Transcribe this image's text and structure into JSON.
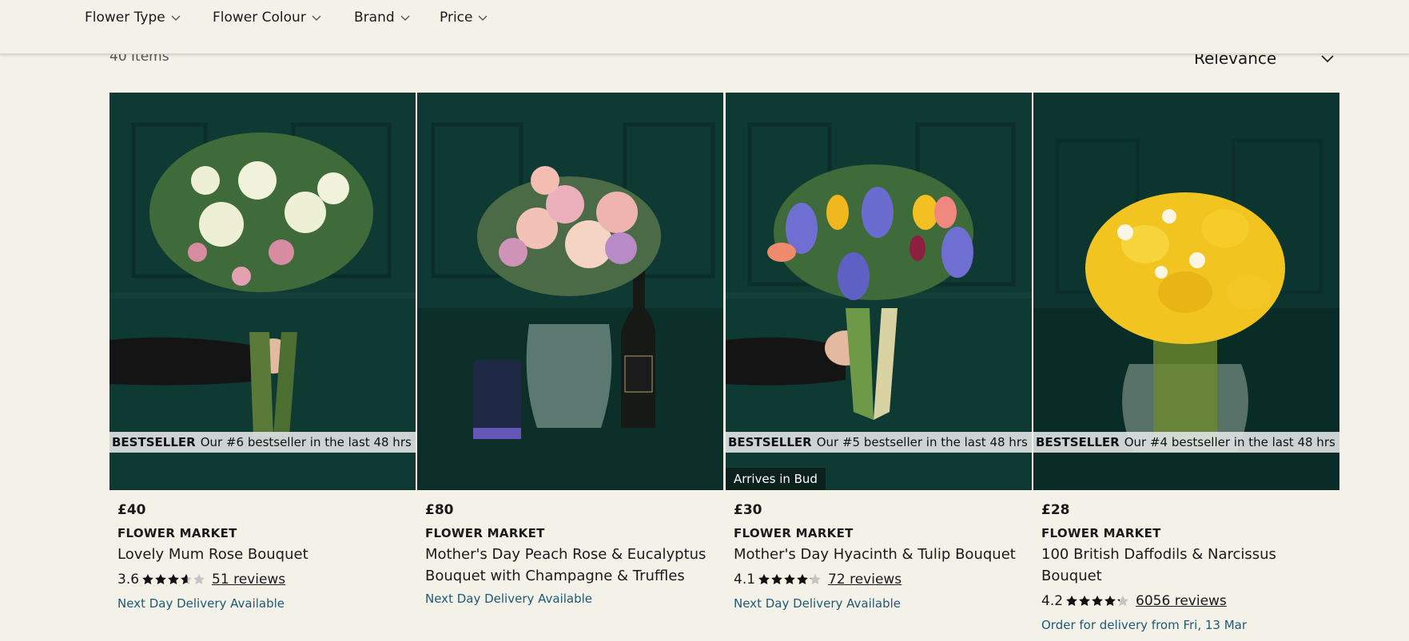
{
  "filters": [
    "Flower Type",
    "Flower Colour",
    "Brand",
    "Price"
  ],
  "results": {
    "count_label": "40 Items",
    "sort_label": "Relevance"
  },
  "products": [
    {
      "price": "£40",
      "brand": "FLOWER MARKET",
      "name": "Lovely Mum Rose Bouquet",
      "rating": "3.6",
      "rating_value": 3.6,
      "reviews": "51 reviews",
      "delivery": "Next Day Delivery Available",
      "badge_label": "BESTSELLER",
      "badge_text": "Our #6 bestseller in the last 48 hrs",
      "overlay": ""
    },
    {
      "price": "£80",
      "brand": "FLOWER MARKET",
      "name": "Mother's Day Peach Rose & Eucalyptus Bouquet with Champagne & Truffles",
      "rating": "",
      "rating_value": null,
      "reviews": "",
      "delivery": "Next Day Delivery Available",
      "badge_label": "",
      "badge_text": "",
      "overlay": ""
    },
    {
      "price": "£30",
      "brand": "FLOWER MARKET",
      "name": "Mother's Day Hyacinth & Tulip Bouquet",
      "rating": "4.1",
      "rating_value": 4.1,
      "reviews": "72 reviews",
      "delivery": "Next Day Delivery Available",
      "badge_label": "BESTSELLER",
      "badge_text": "Our #5 bestseller in the last 48 hrs",
      "overlay": "Arrives in Bud"
    },
    {
      "price": "£28",
      "brand": "FLOWER MARKET",
      "name": "100 British Daffodils & Narcissus Bouquet",
      "rating": "4.2",
      "rating_value": 4.2,
      "reviews": "6056 reviews",
      "delivery": "Order for delivery from Fri, 13 Mar",
      "badge_label": "BESTSELLER",
      "badge_text": "Our #4 bestseller in the last 48 hrs",
      "overlay": ""
    }
  ],
  "colors": {
    "background": "#f3f1e8",
    "photo_bg": "#0f3a33",
    "delivery_link": "#1f5a73"
  }
}
